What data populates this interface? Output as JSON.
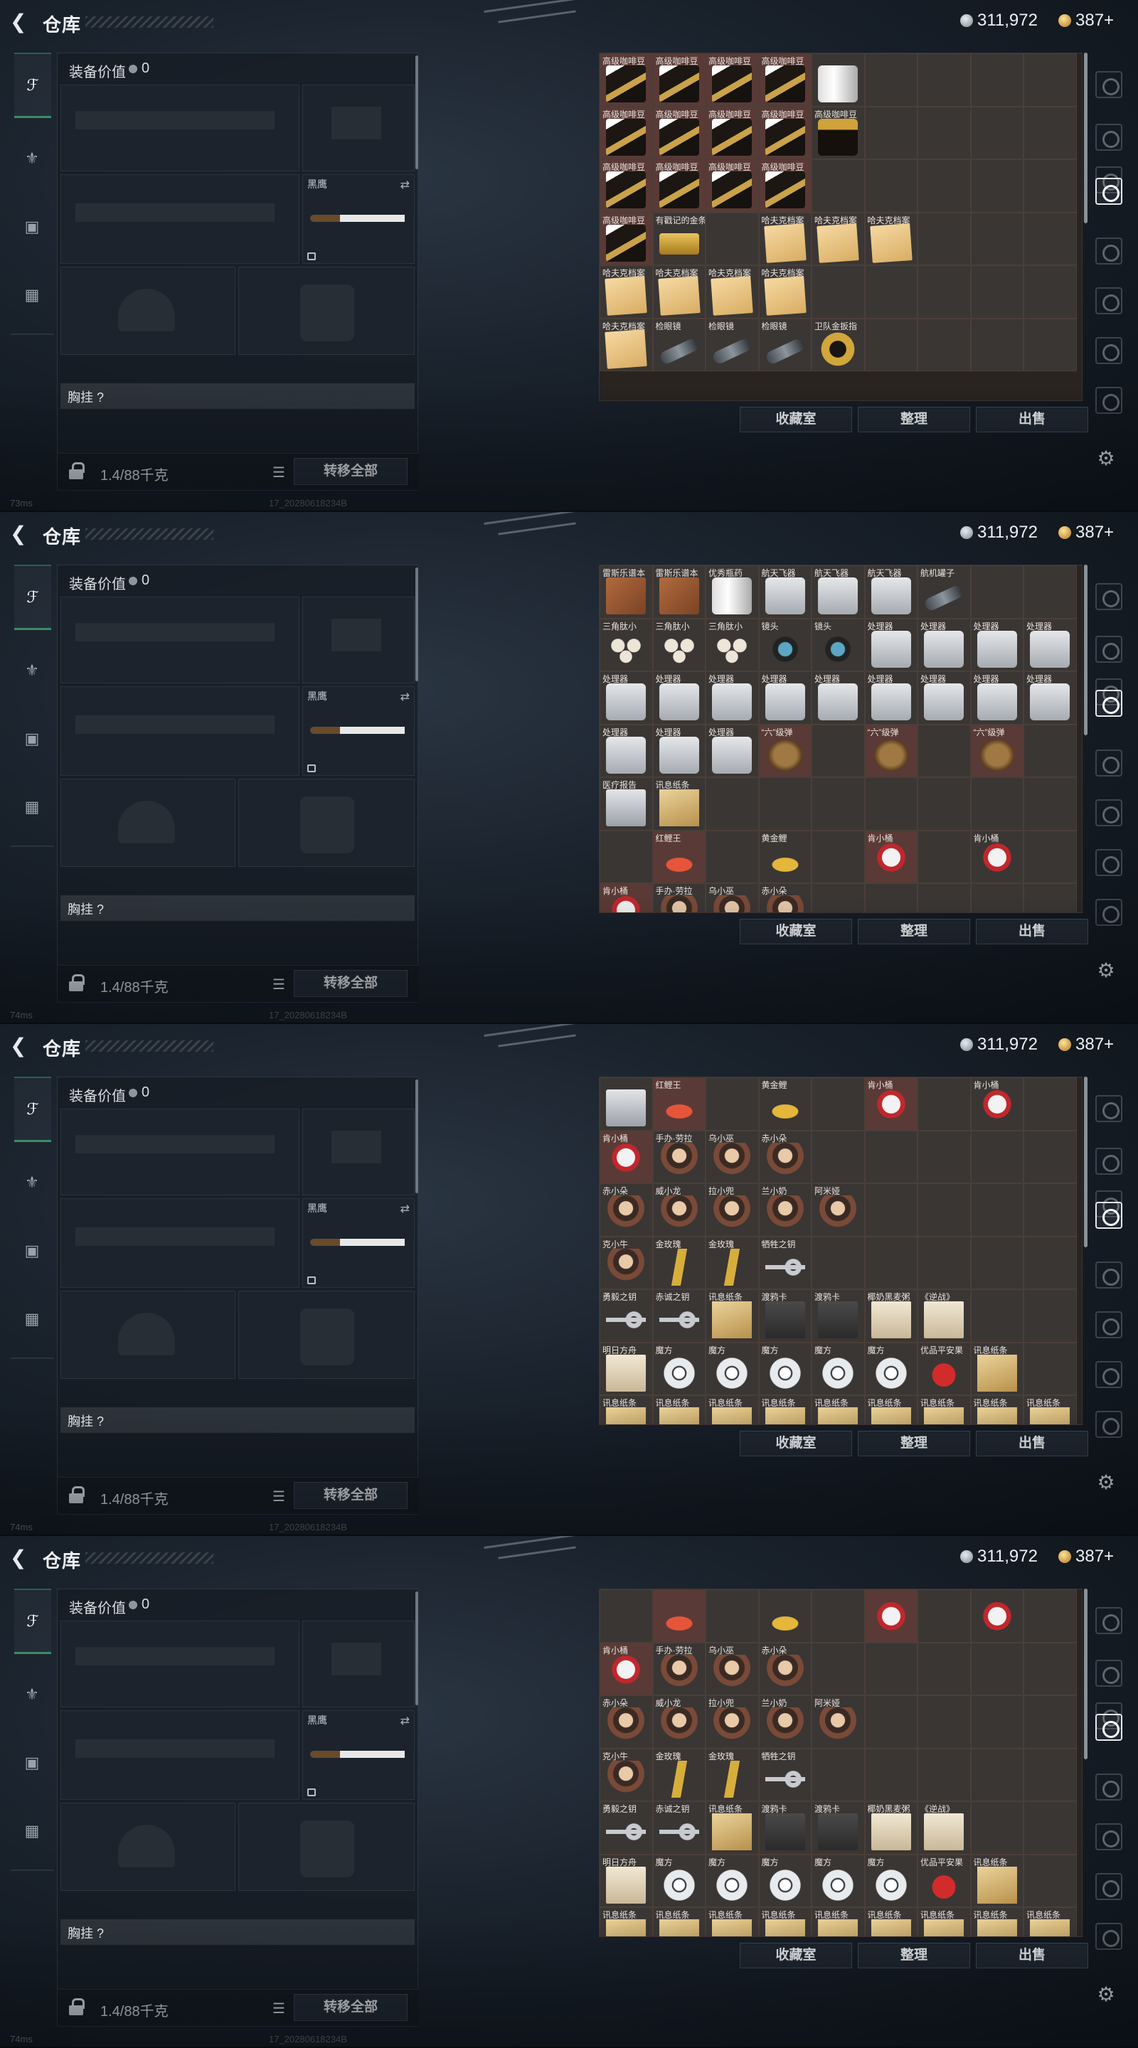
{
  "topbar": {
    "back_icon": "back-arrow-icon",
    "title": "仓库",
    "silver": "311,972",
    "gold": "387+"
  },
  "equipment": {
    "value_label": "装备价值",
    "value": "0",
    "slot_knife": "黑鹰",
    "chest_label": "胸挂 ?",
    "weight": "1.4/88千克",
    "move_all": "转移全部"
  },
  "buttons": {
    "collection": "收藏室",
    "sort": "整理",
    "sell": "出售"
  },
  "status": {
    "build": "17_20280618234B"
  },
  "pings": [
    "73ms",
    "74ms",
    "74ms",
    "74ms"
  ],
  "colors": {
    "item_red": "#5a3a36",
    "item_gray": "#3a3634",
    "accent_green": "#3e8a64"
  },
  "panels": [
    {
      "cells": [
        [
          "高级咖啡豆",
          "coffee",
          "r"
        ],
        [
          "高级咖啡豆",
          "coffee",
          "r"
        ],
        [
          "高级咖啡豆",
          "coffee",
          "r"
        ],
        [
          "高级咖啡豆",
          "coffee",
          "r"
        ],
        [
          "",
          "can",
          "g"
        ],
        [
          "",
          "",
          ""
        ],
        [
          "",
          "",
          ""
        ],
        [
          "",
          "",
          ""
        ],
        [
          "",
          "",
          ""
        ],
        [
          "高级咖啡豆",
          "coffee",
          "r"
        ],
        [
          "高级咖啡豆",
          "coffee",
          "r"
        ],
        [
          "高级咖啡豆",
          "coffee",
          "r"
        ],
        [
          "高级咖啡豆",
          "coffee",
          "r"
        ],
        [
          "高级咖啡豆",
          "bag",
          "g"
        ],
        [
          "",
          "",
          ""
        ],
        [
          "",
          "",
          ""
        ],
        [
          "",
          "",
          ""
        ],
        [
          "",
          "",
          ""
        ],
        [
          "高级咖啡豆",
          "coffee",
          "r"
        ],
        [
          "高级咖啡豆",
          "coffee",
          "r"
        ],
        [
          "高级咖啡豆",
          "coffee",
          "r"
        ],
        [
          "高级咖啡豆",
          "coffee",
          "r"
        ],
        [
          "",
          "",
          ""
        ],
        [
          "",
          "",
          ""
        ],
        [
          "",
          "",
          ""
        ],
        [
          "",
          "",
          ""
        ],
        [
          "",
          "",
          ""
        ],
        [
          "高级咖啡豆",
          "coffee",
          "r"
        ],
        [
          "有戳记的金条",
          "gold",
          "g"
        ],
        [
          "",
          "",
          ""
        ],
        [
          "哈夫克档案",
          "file",
          "g"
        ],
        [
          "哈夫克档案",
          "file",
          "g"
        ],
        [
          "哈夫克档案",
          "file",
          "g"
        ],
        [
          "",
          "",
          ""
        ],
        [
          "",
          "",
          ""
        ],
        [
          "",
          "",
          ""
        ],
        [
          "哈夫克档案",
          "file",
          "g"
        ],
        [
          "哈夫克档案",
          "file",
          "g"
        ],
        [
          "哈夫克档案",
          "file",
          "g"
        ],
        [
          "哈夫克档案",
          "file",
          "g"
        ],
        [
          "",
          "",
          ""
        ],
        [
          "",
          "",
          ""
        ],
        [
          "",
          "",
          ""
        ],
        [
          "",
          "",
          ""
        ],
        [
          "",
          "",
          ""
        ],
        [
          "哈夫克档案",
          "file",
          "g"
        ],
        [
          "检眼镜",
          "scope",
          "g"
        ],
        [
          "检眼镜",
          "scope",
          "g"
        ],
        [
          "检眼镜",
          "scope",
          "g"
        ],
        [
          "卫队金扳指",
          "ring",
          "g"
        ],
        [
          "",
          "",
          ""
        ],
        [
          "",
          "",
          ""
        ],
        [
          "",
          "",
          ""
        ],
        [
          "",
          "",
          ""
        ]
      ]
    },
    {
      "cells": [
        [
          "雷斯乐谱本",
          "book",
          "g"
        ],
        [
          "雷斯乐谱本",
          "book",
          "g"
        ],
        [
          "优秀瓶药",
          "can",
          "g"
        ],
        [
          "航天飞器",
          "kit",
          "g"
        ],
        [
          "航天飞器",
          "kit",
          "g"
        ],
        [
          "航天飞器",
          "kit",
          "g"
        ],
        [
          "航机罐子",
          "scope",
          "g"
        ],
        [
          "",
          "",
          ""
        ],
        [
          "",
          "",
          ""
        ],
        [
          "三角肽小",
          "pill",
          "g"
        ],
        [
          "三角肽小",
          "pill",
          "g"
        ],
        [
          "三角肽小",
          "pill",
          "g"
        ],
        [
          "镜头",
          "watch",
          "g"
        ],
        [
          "镜头",
          "watch",
          "g"
        ],
        [
          "处理器",
          "kit",
          "g"
        ],
        [
          "处理器",
          "kit",
          "g"
        ],
        [
          "处理器",
          "kit",
          "g"
        ],
        [
          "处理器",
          "kit",
          "g"
        ],
        [
          "处理器",
          "kit",
          "g"
        ],
        [
          "处理器",
          "kit",
          "g"
        ],
        [
          "处理器",
          "kit",
          "g"
        ],
        [
          "处理器",
          "kit",
          "g"
        ],
        [
          "处理器",
          "kit",
          "g"
        ],
        [
          "处理器",
          "kit",
          "g"
        ],
        [
          "处理器",
          "kit",
          "g"
        ],
        [
          "处理器",
          "kit",
          "g"
        ],
        [
          "处理器",
          "kit",
          "g"
        ],
        [
          "处理器",
          "kit",
          "g"
        ],
        [
          "处理器",
          "kit",
          "g"
        ],
        [
          "处理器",
          "kit",
          "g"
        ],
        [
          "“六”级弹",
          "glove",
          "r"
        ],
        [
          "",
          "",
          ""
        ],
        [
          "“六”级弹",
          "glove",
          "r"
        ],
        [
          "",
          "",
          ""
        ],
        [
          "“六”级弹",
          "glove",
          "r"
        ],
        [
          "",
          "",
          ""
        ],
        [
          "医疗报告",
          "report",
          "g"
        ],
        [
          "讯息纸条",
          "paper",
          "g"
        ],
        [
          "",
          "",
          ""
        ],
        [
          "",
          "",
          ""
        ],
        [
          "",
          "",
          ""
        ],
        [
          "",
          "",
          ""
        ],
        [
          "",
          "",
          ""
        ],
        [
          "",
          "",
          ""
        ],
        [
          "",
          "",
          ""
        ],
        [
          "",
          "",
          ""
        ],
        [
          "红鲤王",
          "fish",
          "r"
        ],
        [
          "",
          "",
          ""
        ],
        [
          "黄金鲤",
          "gfish",
          "g"
        ],
        [
          "",
          "",
          ""
        ],
        [
          "肯小桶",
          "robot",
          "r"
        ],
        [
          "",
          "",
          ""
        ],
        [
          "肯小桶",
          "robot",
          "g"
        ],
        [
          "",
          "",
          ""
        ],
        [
          "肯小桶",
          "robot",
          "r"
        ],
        [
          "手办·劳拉",
          "doll",
          "g"
        ],
        [
          "乌小巫",
          "doll",
          "g"
        ],
        [
          "赤小朵",
          "doll",
          "g"
        ],
        [
          "",
          "",
          ""
        ],
        [
          "",
          "",
          ""
        ],
        [
          "",
          "",
          ""
        ],
        [
          "",
          "",
          ""
        ],
        [
          "",
          "",
          ""
        ]
      ]
    },
    {
      "cells": [
        [
          "",
          "report",
          "g"
        ],
        [
          "红鲤王",
          "fish",
          "r"
        ],
        [
          "",
          "",
          ""
        ],
        [
          "黄金鲤",
          "gfish",
          "g"
        ],
        [
          "",
          "",
          ""
        ],
        [
          "肯小桶",
          "robot",
          "r"
        ],
        [
          "",
          "",
          ""
        ],
        [
          "肯小桶",
          "robot",
          "g"
        ],
        [
          "",
          "",
          ""
        ],
        [
          "肯小桶",
          "robot",
          "r"
        ],
        [
          "手办·劳拉",
          "doll",
          "g"
        ],
        [
          "乌小巫",
          "doll",
          "g"
        ],
        [
          "赤小朵",
          "doll",
          "g"
        ],
        [
          "",
          "",
          ""
        ],
        [
          "",
          "",
          ""
        ],
        [
          "",
          "",
          ""
        ],
        [
          "",
          "",
          ""
        ],
        [
          "",
          "",
          ""
        ],
        [
          "赤小朵",
          "doll",
          "g"
        ],
        [
          "威小龙",
          "doll",
          "g"
        ],
        [
          "拉小兜",
          "doll",
          "g"
        ],
        [
          "兰小奶",
          "doll",
          "g"
        ],
        [
          "阿米娅",
          "doll",
          "g"
        ],
        [
          "",
          "",
          ""
        ],
        [
          "",
          "",
          ""
        ],
        [
          "",
          "",
          ""
        ],
        [
          "",
          "",
          ""
        ],
        [
          "克小牛",
          "doll",
          "g"
        ],
        [
          "金玫瑰",
          "rose",
          "g"
        ],
        [
          "金玫瑰",
          "rose",
          "g"
        ],
        [
          "牺牲之钥",
          "key",
          "g"
        ],
        [
          "",
          "",
          ""
        ],
        [
          "",
          "",
          ""
        ],
        [
          "",
          "",
          ""
        ],
        [
          "",
          "",
          ""
        ],
        [
          "",
          "",
          ""
        ],
        [
          "勇毅之钥",
          "key",
          "g"
        ],
        [
          "赤诚之钥",
          "key",
          "g"
        ],
        [
          "讯息纸条",
          "paper",
          "g"
        ],
        [
          "渡鸦卡",
          "tape",
          "g"
        ],
        [
          "渡鸦卡",
          "tape",
          "g"
        ],
        [
          "椰奶黑麦粥",
          "card",
          "g"
        ],
        [
          "《逆战》",
          "card",
          "g"
        ],
        [
          "",
          "",
          ""
        ],
        [
          "",
          "",
          ""
        ],
        [
          "明日方舟",
          "card",
          "g"
        ],
        [
          "魔方",
          "drum",
          "g"
        ],
        [
          "魔方",
          "drum",
          "g"
        ],
        [
          "魔方",
          "drum",
          "g"
        ],
        [
          "魔方",
          "drum",
          "g"
        ],
        [
          "魔方",
          "drum",
          "g"
        ],
        [
          "优品平安果",
          "apple",
          "g"
        ],
        [
          "讯息纸条",
          "paper",
          "g"
        ],
        [
          "",
          "",
          ""
        ],
        [
          "讯息纸条",
          "paper",
          "g"
        ],
        [
          "讯息纸条",
          "paper",
          "g"
        ],
        [
          "讯息纸条",
          "paper",
          "g"
        ],
        [
          "讯息纸条",
          "paper",
          "g"
        ],
        [
          "讯息纸条",
          "paper",
          "g"
        ],
        [
          "讯息纸条",
          "paper",
          "g"
        ],
        [
          "讯息纸条",
          "paper",
          "g"
        ],
        [
          "讯息纸条",
          "paper",
          "g"
        ],
        [
          "讯息纸条",
          "paper",
          "g"
        ]
      ]
    },
    {
      "cells": [
        [
          "",
          "",
          ""
        ],
        [
          "",
          "fish",
          "r"
        ],
        [
          "",
          "",
          ""
        ],
        [
          "",
          "gfish",
          "g"
        ],
        [
          "",
          "",
          ""
        ],
        [
          "",
          "robot",
          "r"
        ],
        [
          "",
          "",
          ""
        ],
        [
          "",
          "robot",
          "g"
        ],
        [
          "",
          "",
          ""
        ],
        [
          "肯小桶",
          "robot",
          "r"
        ],
        [
          "手办·劳拉",
          "doll",
          "g"
        ],
        [
          "乌小巫",
          "doll",
          "g"
        ],
        [
          "赤小朵",
          "doll",
          "g"
        ],
        [
          "",
          "",
          ""
        ],
        [
          "",
          "",
          ""
        ],
        [
          "",
          "",
          ""
        ],
        [
          "",
          "",
          ""
        ],
        [
          "",
          "",
          ""
        ],
        [
          "赤小朵",
          "doll",
          "g"
        ],
        [
          "威小龙",
          "doll",
          "g"
        ],
        [
          "拉小兜",
          "doll",
          "g"
        ],
        [
          "兰小奶",
          "doll",
          "g"
        ],
        [
          "阿米娅",
          "doll",
          "g"
        ],
        [
          "",
          "",
          ""
        ],
        [
          "",
          "",
          ""
        ],
        [
          "",
          "",
          ""
        ],
        [
          "",
          "",
          ""
        ],
        [
          "克小牛",
          "doll",
          "g"
        ],
        [
          "金玫瑰",
          "rose",
          "g"
        ],
        [
          "金玫瑰",
          "rose",
          "g"
        ],
        [
          "牺牲之钥",
          "key",
          "g"
        ],
        [
          "",
          "",
          ""
        ],
        [
          "",
          "",
          ""
        ],
        [
          "",
          "",
          ""
        ],
        [
          "",
          "",
          ""
        ],
        [
          "",
          "",
          ""
        ],
        [
          "勇毅之钥",
          "key",
          "g"
        ],
        [
          "赤诚之钥",
          "key",
          "g"
        ],
        [
          "讯息纸条",
          "paper",
          "g"
        ],
        [
          "渡鸦卡",
          "tape",
          "g"
        ],
        [
          "渡鸦卡",
          "tape",
          "g"
        ],
        [
          "椰奶黑麦粥",
          "card",
          "g"
        ],
        [
          "《逆战》",
          "card",
          "g"
        ],
        [
          "",
          "",
          ""
        ],
        [
          "",
          "",
          ""
        ],
        [
          "明日方舟",
          "card",
          "g"
        ],
        [
          "魔方",
          "drum",
          "g"
        ],
        [
          "魔方",
          "drum",
          "g"
        ],
        [
          "魔方",
          "drum",
          "g"
        ],
        [
          "魔方",
          "drum",
          "g"
        ],
        [
          "魔方",
          "drum",
          "g"
        ],
        [
          "优品平安果",
          "apple",
          "g"
        ],
        [
          "讯息纸条",
          "paper",
          "g"
        ],
        [
          "",
          "",
          ""
        ],
        [
          "讯息纸条",
          "paper",
          "g"
        ],
        [
          "讯息纸条",
          "paper",
          "g"
        ],
        [
          "讯息纸条",
          "paper",
          "g"
        ],
        [
          "讯息纸条",
          "paper",
          "g"
        ],
        [
          "讯息纸条",
          "paper",
          "g"
        ],
        [
          "讯息纸条",
          "paper",
          "g"
        ],
        [
          "讯息纸条",
          "paper",
          "g"
        ],
        [
          "讯息纸条",
          "paper",
          "g"
        ],
        [
          "讯息纸条",
          "paper",
          "g"
        ]
      ]
    }
  ]
}
